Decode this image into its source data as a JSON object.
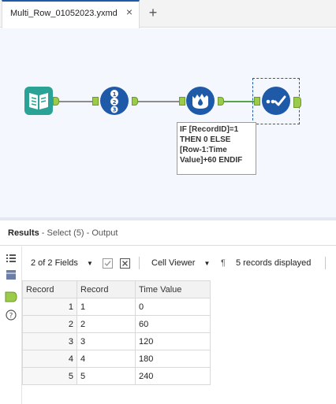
{
  "tabs": [
    {
      "label": "Multi_Row_01052023.yxmd",
      "close": "×"
    }
  ],
  "add_tab": "+",
  "annotation": {
    "lines": [
      "IF [RecordID]=1",
      "THEN 0 ELSE",
      "[Row-1:Time",
      "Value]+60 ENDIF"
    ]
  },
  "results": {
    "title": "Results",
    "subtitle": " - Select (5) - Output"
  },
  "toolbar": {
    "fields": "2 of 2 Fields",
    "viewer": "Cell Viewer",
    "pilcrow": "¶",
    "records": "5 records displayed"
  },
  "table": {
    "headers": [
      "Record",
      "Record",
      "Time Value"
    ],
    "rows": [
      [
        "1",
        "1",
        "0"
      ],
      [
        "2",
        "2",
        "60"
      ],
      [
        "3",
        "3",
        "120"
      ],
      [
        "4",
        "4",
        "180"
      ],
      [
        "5",
        "5",
        "240"
      ]
    ]
  },
  "colors": {
    "input_tool": "#2aa396",
    "recordid_tool": "#1f5aa8",
    "multirow_tool": "#1f5aa8",
    "select_tool": "#1f5aa8",
    "tab_accent": "#1f5aa8"
  },
  "icons": [
    "book-input-icon",
    "record-id-icon",
    "multi-row-formula-icon",
    "select-tool-icon",
    "list-icon",
    "grid-icon",
    "output-anchor-icon",
    "help-icon",
    "dropdown-caret-icon",
    "checkbox-icon",
    "close-box-icon"
  ]
}
